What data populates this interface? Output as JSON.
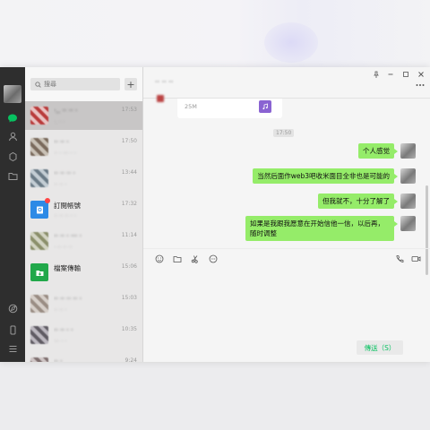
{
  "search": {
    "placeholder": "搜尋"
  },
  "conversations": [
    {
      "name": "·.. ·· ·· ·",
      "preview": "·. · ·",
      "time": "17:53",
      "active": true,
      "avatar_colors": [
        "#b93b3b",
        "#e9c3c3"
      ]
    },
    {
      "name": "·· ·· ·",
      "preview": "·· · ··· · ·",
      "time": "17:50",
      "active": false,
      "avatar_colors": [
        "#7a6a5c",
        "#c9c1b6"
      ]
    },
    {
      "name": "·· ·· ·· ·",
      "preview": "·· ·· ·",
      "time": "13:44",
      "active": false,
      "avatar_colors": [
        "#6a7a86",
        "#c3cdd4"
      ]
    },
    {
      "name": "訂閱帳號",
      "preview": "·· ·· ·· · ·",
      "time": "17:32",
      "active": false,
      "icon": "subscription-icon",
      "badge": true,
      "avatar_colors": [
        "#2d8ae6",
        "#2d8ae6"
      ]
    },
    {
      "name": "·· ·· · ··· ·",
      "preview": "· ·· ·· ··",
      "time": "11:14",
      "active": false,
      "avatar_colors": [
        "#8b8f6b",
        "#d3d4c3"
      ]
    },
    {
      "name": "檔案傳輸",
      "preview": "",
      "time": "15:06",
      "active": false,
      "icon": "file-transfer-icon",
      "avatar_colors": [
        "#21a84a",
        "#21a84a"
      ]
    },
    {
      "name": "·· ·· ·· ·· ·",
      "preview": "·· ·· ·",
      "time": "15:03",
      "active": false,
      "avatar_colors": [
        "#9a8d84",
        "#d6cfc9"
      ]
    },
    {
      "name": "·· ·· · ·",
      "preview": "··· · ·",
      "time": "10:35",
      "active": false,
      "avatar_colors": [
        "#5f5b63",
        "#bcb8c0"
      ]
    },
    {
      "name": "·· ·",
      "preview": "·· ·",
      "time": "9:24",
      "active": false,
      "avatar_colors": [
        "#7f6f6f",
        "#cfc6c6"
      ]
    }
  ],
  "chat": {
    "title": "·· ·· ··",
    "file_card": {
      "size": "25M"
    },
    "time_separator": "17:50",
    "messages": [
      {
        "text": "个人感觉"
      },
      {
        "text": "当然后面作web3吧收米面目全非也是可能的"
      },
      {
        "text": "但我就不，十分了解了"
      },
      {
        "text": "如果是我跟我愿意在开始信他一信，以后再，随时调整"
      }
    ],
    "send_label": "傳送（S）"
  },
  "colors": {
    "accent": "#07c160",
    "bubble": "#95ec69",
    "sidebar": "#2e2e2e"
  }
}
